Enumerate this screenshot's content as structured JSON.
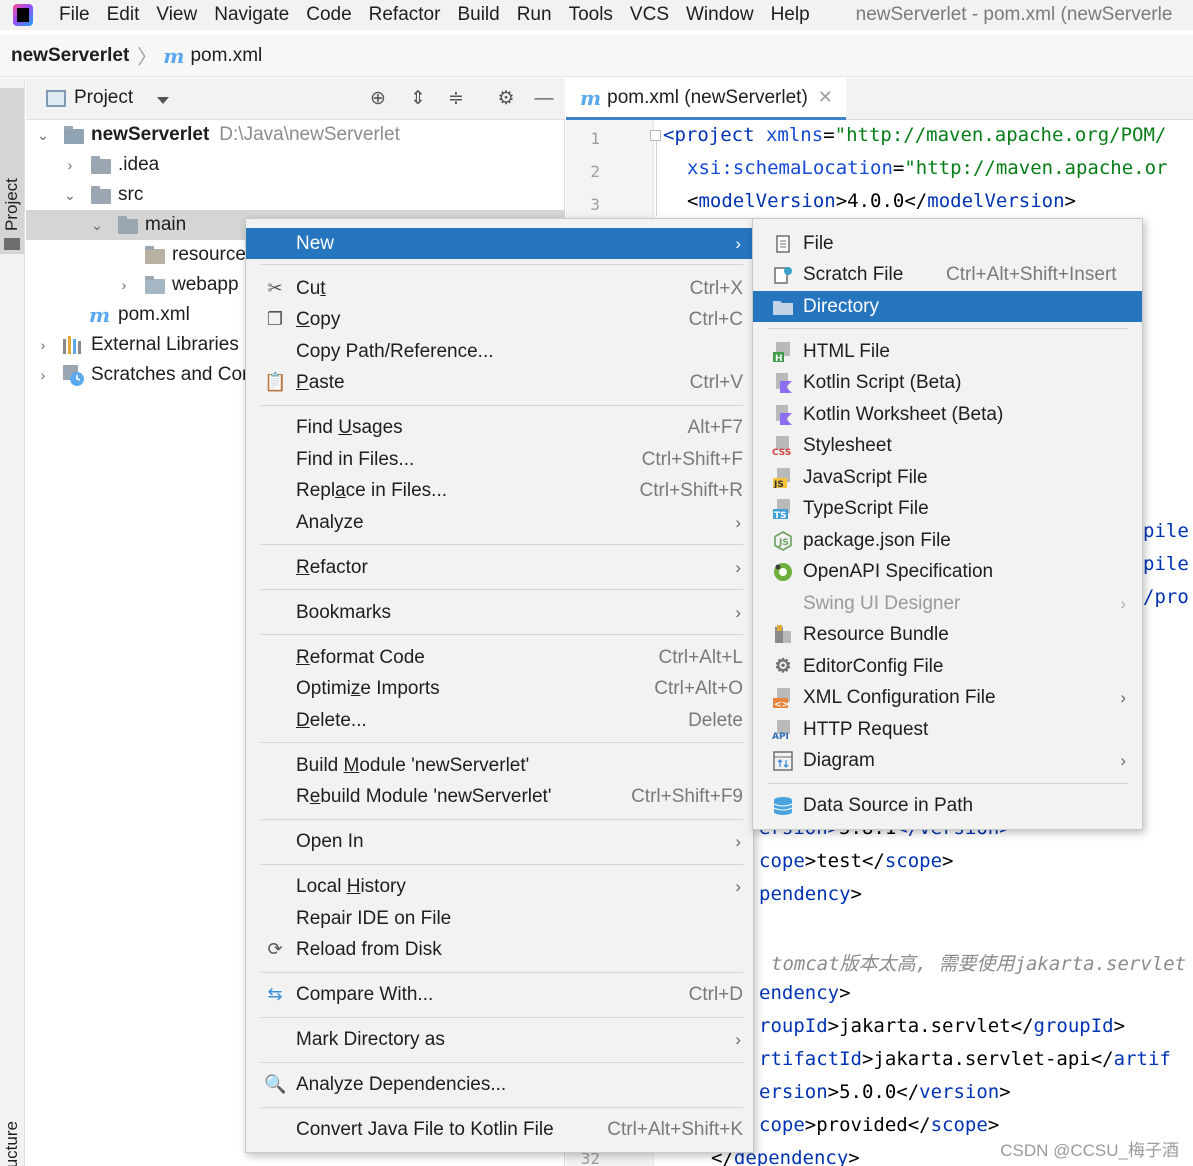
{
  "menubar": {
    "items": [
      {
        "label": "File"
      },
      {
        "label": "Edit"
      },
      {
        "label": "View"
      },
      {
        "label": "Navigate"
      },
      {
        "label": "Code"
      },
      {
        "label": "Refactor"
      },
      {
        "label": "Build"
      },
      {
        "label": "Run"
      },
      {
        "label": "Tools"
      },
      {
        "label": "VCS"
      },
      {
        "label": "Window"
      },
      {
        "label": "Help"
      }
    ],
    "window_title": "newServerlet - pom.xml (newServerle"
  },
  "navbar": {
    "project": "newServerlet",
    "file": "pom.xml"
  },
  "left_strip": {
    "project_label": "Project",
    "structure_label": "Structure"
  },
  "project_panel": {
    "title": "Project",
    "tree": [
      {
        "label": "newServerlet",
        "path": "D:\\Java\\newServerlet"
      },
      {
        "label": ".idea"
      },
      {
        "label": "src"
      },
      {
        "label": "main"
      },
      {
        "label": "resource"
      },
      {
        "label": "webapp"
      },
      {
        "label": "pom.xml"
      },
      {
        "label": "External Libraries"
      },
      {
        "label": "Scratches and Cor"
      }
    ]
  },
  "editor": {
    "tab_label": "pom.xml (newServerlet)",
    "line_numbers": [
      "1",
      "2",
      "3",
      "32"
    ],
    "code": {
      "l1_tag": "project",
      "l1_attr": "xmlns",
      "l1_val": "\"http://maven.apache.org/POM/",
      "l2_attr": "xsi:schemaLocation",
      "l2_val": "\"http://maven.apache.or",
      "l3_pre": "<",
      "l3_tag": "modelVersion",
      "l3_mid": ">4.0.0</",
      "l3_end": ">",
      "r1": "pile",
      "r2": "pile",
      "r3": "/pro",
      "c1_pre": "ersion>",
      "c1_mid": "5.8.1",
      "c1_end": "</version>",
      "c2_tag": "cope",
      "c2_mid": ">test</",
      "c2_tag2": "scope",
      "c2_end": ">",
      "c3_tag": "pendency",
      "c3_end": ">",
      "c4_comment": "tomcat版本太高, 需要使用jakarta.servlet",
      "c5_tag": "endency",
      "c5_end": ">",
      "c6_tag": "roupId",
      "c6_mid": ">jakarta.servlet</",
      "c6_tag2": "groupId",
      "c6_end": ">",
      "c7_tag": "rtifactId",
      "c7_mid": ">jakarta.servlet-api</",
      "c7_tag2": "artif",
      "c8_tag": "ersion",
      "c8_mid": ">5.0.0</",
      "c8_tag2": "version",
      "c8_end": ">",
      "c9_tag": "cope",
      "c9_mid": ">provided</",
      "c9_tag2": "scope",
      "c9_end": ">",
      "c10_pre": "</",
      "c10_tag": "dependency",
      "c10_end": ">"
    }
  },
  "context_menu": {
    "new": "New",
    "cut": {
      "pre": "Cu",
      "u": "t",
      "shortcut": "Ctrl+X"
    },
    "copy": {
      "u": "C",
      "post": "opy",
      "shortcut": "Ctrl+C"
    },
    "copy_path": "Copy Path/Reference...",
    "paste": {
      "u": "P",
      "post": "aste",
      "shortcut": "Ctrl+V"
    },
    "find_usages": {
      "pre": "Find ",
      "u": "U",
      "post": "sages",
      "shortcut": "Alt+F7"
    },
    "find_in_files": {
      "label": "Find in Files...",
      "shortcut": "Ctrl+Shift+F"
    },
    "replace_in_files": {
      "pre": "Repl",
      "u": "a",
      "post": "ce in Files...",
      "shortcut": "Ctrl+Shift+R"
    },
    "analyze": "Analyze",
    "refactor": {
      "u": "R",
      "post": "efactor"
    },
    "bookmarks": "Bookmarks",
    "reformat": {
      "u": "R",
      "post": "eformat Code",
      "shortcut": "Ctrl+Alt+L"
    },
    "optimize": {
      "pre": "Optimi",
      "u": "z",
      "post": "e Imports",
      "shortcut": "Ctrl+Alt+O"
    },
    "delete": {
      "u": "D",
      "post": "elete...",
      "shortcut": "Delete"
    },
    "build_module": {
      "pre": "Build ",
      "u": "M",
      "post": "odule 'newServerlet'"
    },
    "rebuild_module": {
      "pre": "R",
      "u": "e",
      "post": "build Module 'newServerlet'",
      "shortcut": "Ctrl+Shift+F9"
    },
    "open_in": "Open In",
    "local_history": {
      "pre": "Local ",
      "u": "H",
      "post": "istory"
    },
    "repair_ide": "Repair IDE on File",
    "reload": "Reload from Disk",
    "compare": {
      "label": "Compare With...",
      "shortcut": "Ctrl+D"
    },
    "mark_directory": "Mark Directory as",
    "analyze_deps": "Analyze Dependencies...",
    "convert": {
      "label": "Convert Java File to Kotlin File",
      "shortcut": "Ctrl+Alt+Shift+K"
    }
  },
  "submenu": {
    "file": "File",
    "scratch_file": {
      "label": "Scratch File",
      "shortcut": "Ctrl+Alt+Shift+Insert"
    },
    "directory": "Directory",
    "html_file": "HTML File",
    "kotlin_script": "Kotlin Script (Beta)",
    "kotlin_worksheet": "Kotlin Worksheet (Beta)",
    "stylesheet": "Stylesheet",
    "javascript_file": "JavaScript File",
    "typescript_file": "TypeScript File",
    "package_json": "package.json File",
    "openapi": "OpenAPI Specification",
    "swing_ui": "Swing UI Designer",
    "resource_bundle": "Resource Bundle",
    "editorconfig": "EditorConfig File",
    "xml_config": "XML Configuration File",
    "http_request": "HTTP Request",
    "diagram": "Diagram",
    "data_source": "Data Source in Path",
    "icon_text": {
      "html": "H",
      "css": "CSS",
      "js": "JS",
      "ts": "TS",
      "api": "API",
      "xml": "<>"
    }
  },
  "watermark": "CSDN @CCSU_梅子酒",
  "colors": {
    "selection": "#2675bf",
    "menu_bg": "#f2f2f2",
    "tree_selected": "#d5d5d5"
  }
}
